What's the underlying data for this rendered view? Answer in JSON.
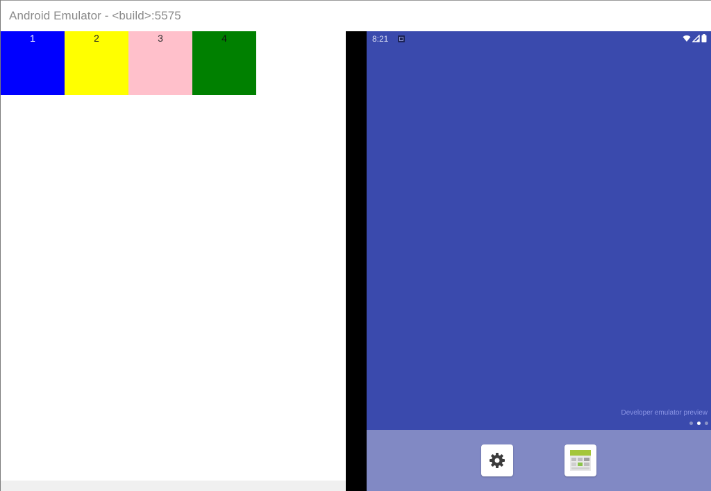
{
  "window": {
    "title": "Android Emulator - <build>:5575"
  },
  "left_pane": {
    "cells": [
      {
        "label": "1",
        "color": "#0000ff",
        "text_color": "#ffffff"
      },
      {
        "label": "2",
        "color": "#ffff00",
        "text_color": "#222222"
      },
      {
        "label": "3",
        "color": "#ffc0cb",
        "text_color": "#333333"
      },
      {
        "label": "4",
        "color": "#008000",
        "text_color": "#111111"
      }
    ]
  },
  "emulator": {
    "status_bar": {
      "time": "8:21",
      "icons": [
        "notification-icon",
        "wifi-icon",
        "cell-signal-icon",
        "battery-icon"
      ]
    },
    "home": {
      "watermark": "Developer emulator preview",
      "page_count": 3,
      "active_page": 2
    },
    "dock": {
      "apps": [
        {
          "icon": "settings-gear-icon"
        },
        {
          "icon": "dev-tools-icon"
        }
      ]
    },
    "colors": {
      "screen_bg": "#3a4aad",
      "dock_bg": "#8189c4"
    }
  }
}
